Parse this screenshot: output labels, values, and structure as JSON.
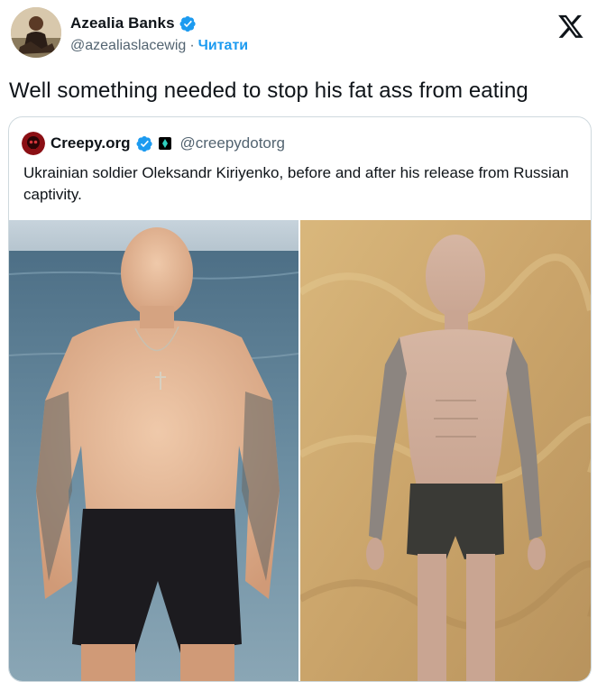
{
  "tweet": {
    "author": {
      "display_name": "Azealia Banks",
      "handle": "@azealiaslacewig",
      "separator": "·",
      "follow_label": "Читати"
    },
    "text": "Well something needed to stop his fat ass from eating",
    "platform_icon": "x-logo-icon"
  },
  "quoted_tweet": {
    "author": {
      "display_name": "Creepy.org",
      "handle": "@creepydotorg"
    },
    "text": "Ukrainian soldier Oleksandr Kiriyenko, before and after his release from Russian captivity.",
    "images": [
      {
        "name": "before-photo",
        "description_icon": "photo-before-captivity"
      },
      {
        "name": "after-photo",
        "description_icon": "photo-after-captivity"
      }
    ]
  },
  "colors": {
    "text": "#0f1419",
    "secondary_text": "#536471",
    "link": "#1d9bf0",
    "verified": "#1d9bf0",
    "border": "#cfd9de"
  }
}
